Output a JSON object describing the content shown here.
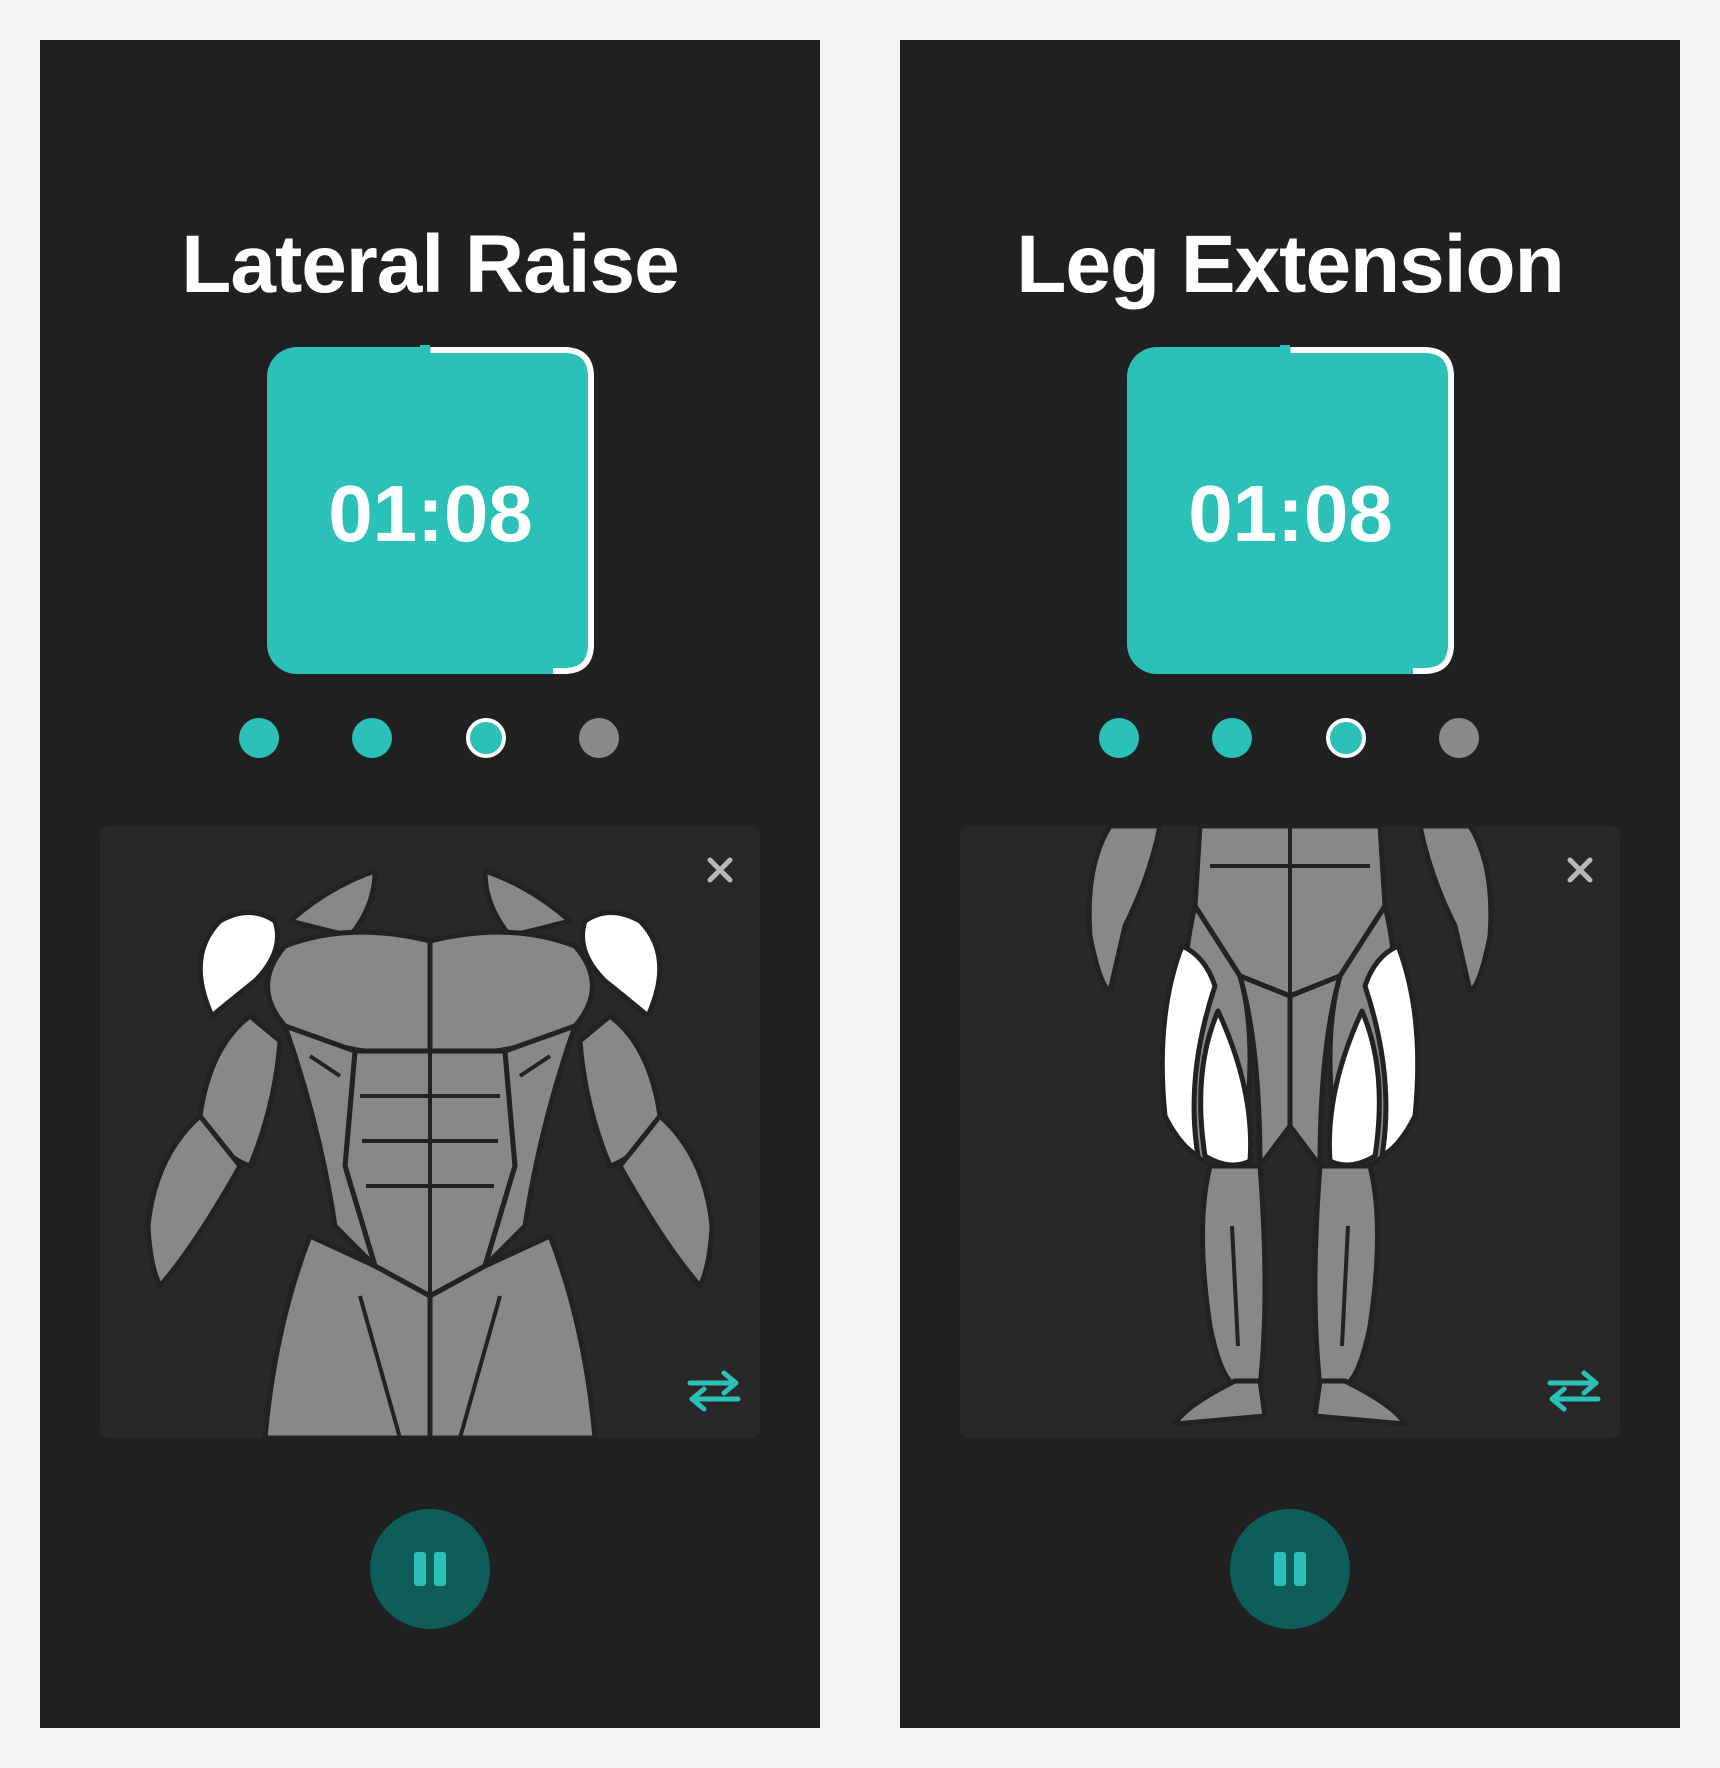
{
  "colors": {
    "accent": "#2cc1b8",
    "accent_dark": "#0d5e59",
    "screen_bg": "#202020",
    "panel_bg": "#282828",
    "muscle": "#888888",
    "muscle_active": "#ffffff",
    "dot_pending": "#8a8a8a"
  },
  "screens": [
    {
      "exercise_title": "Lateral Raise",
      "timer": "01:08",
      "timer_progress": 0.9,
      "steps": [
        "done",
        "done",
        "current",
        "pending"
      ],
      "body_view": "upper-body-front",
      "highlighted_muscles": [
        "front deltoids"
      ],
      "icons": {
        "close": "close-icon",
        "swap": "swap-arrows-icon",
        "pause": "pause-icon"
      }
    },
    {
      "exercise_title": "Leg Extension",
      "timer": "01:08",
      "timer_progress": 0.9,
      "steps": [
        "done",
        "done",
        "current",
        "pending"
      ],
      "body_view": "lower-body-front",
      "highlighted_muscles": [
        "quadriceps"
      ],
      "icons": {
        "close": "close-icon",
        "swap": "swap-arrows-icon",
        "pause": "pause-icon"
      }
    }
  ]
}
